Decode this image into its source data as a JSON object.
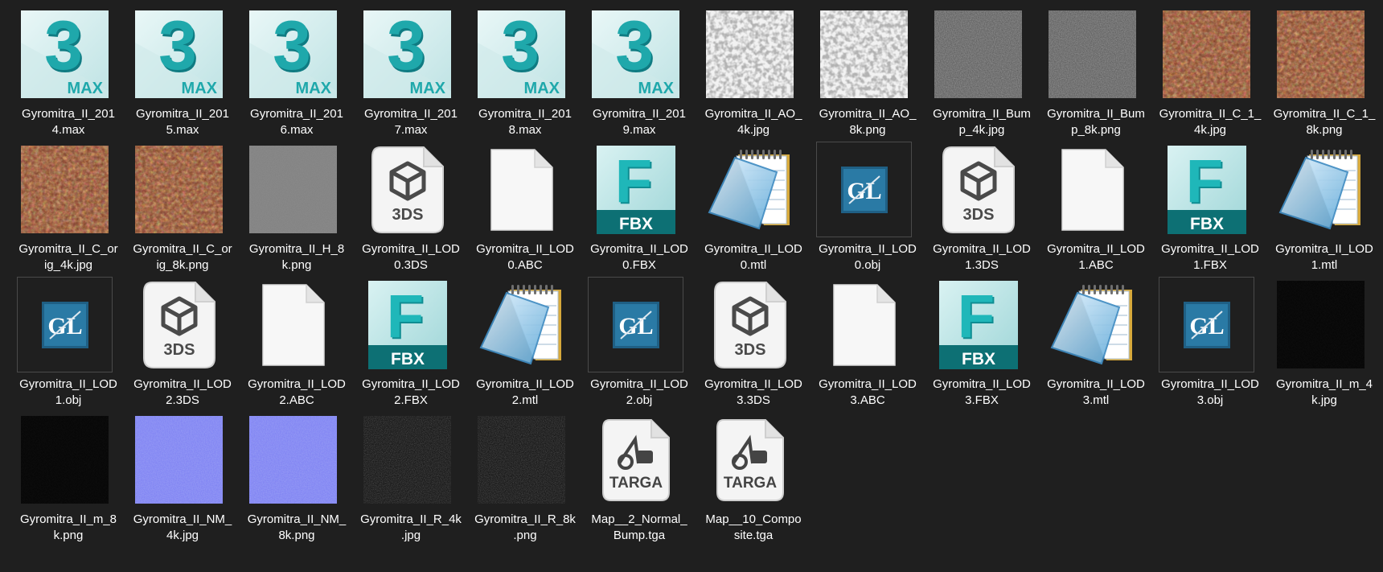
{
  "window": {
    "view": "large-icons"
  },
  "colors": {
    "background": "#1f1f1f",
    "max_teal": "#1fa8ab",
    "fbx_teal": "#0d7074",
    "text": "#ffffff"
  },
  "files": [
    {
      "line1": "Gyromitra_II_201",
      "line2": "4.max",
      "kind": "max"
    },
    {
      "line1": "Gyromitra_II_201",
      "line2": "5.max",
      "kind": "max"
    },
    {
      "line1": "Gyromitra_II_201",
      "line2": "6.max",
      "kind": "max"
    },
    {
      "line1": "Gyromitra_II_201",
      "line2": "7.max",
      "kind": "max"
    },
    {
      "line1": "Gyromitra_II_201",
      "line2": "8.max",
      "kind": "max"
    },
    {
      "line1": "Gyromitra_II_201",
      "line2": "9.max",
      "kind": "max"
    },
    {
      "line1": "Gyromitra_II_AO_",
      "line2": "4k.jpg",
      "kind": "ao"
    },
    {
      "line1": "Gyromitra_II_AO_",
      "line2": "8k.png",
      "kind": "ao"
    },
    {
      "line1": "Gyromitra_II_Bum",
      "line2": "p_4k.jpg",
      "kind": "bump"
    },
    {
      "line1": "Gyromitra_II_Bum",
      "line2": "p_8k.png",
      "kind": "bump"
    },
    {
      "line1": "Gyromitra_II_C_1_",
      "line2": "4k.jpg",
      "kind": "color"
    },
    {
      "line1": "Gyromitra_II_C_1_",
      "line2": "8k.png",
      "kind": "color"
    },
    {
      "line1": "Gyromitra_II_C_or",
      "line2": "ig_4k.jpg",
      "kind": "color"
    },
    {
      "line1": "Gyromitra_II_C_or",
      "line2": "ig_8k.png",
      "kind": "color"
    },
    {
      "line1": "Gyromitra_II_H_8",
      "line2": "k.png",
      "kind": "height"
    },
    {
      "line1": "Gyromitra_II_LOD",
      "line2": "0.3DS",
      "kind": "3ds"
    },
    {
      "line1": "Gyromitra_II_LOD",
      "line2": "0.ABC",
      "kind": "blank"
    },
    {
      "line1": "Gyromitra_II_LOD",
      "line2": "0.FBX",
      "kind": "fbx"
    },
    {
      "line1": "Gyromitra_II_LOD",
      "line2": "0.mtl",
      "kind": "notepad"
    },
    {
      "line1": "Gyromitra_II_LOD",
      "line2": "0.obj",
      "kind": "obj"
    },
    {
      "line1": "Gyromitra_II_LOD",
      "line2": "1.3DS",
      "kind": "3ds"
    },
    {
      "line1": "Gyromitra_II_LOD",
      "line2": "1.ABC",
      "kind": "blank"
    },
    {
      "line1": "Gyromitra_II_LOD",
      "line2": "1.FBX",
      "kind": "fbx"
    },
    {
      "line1": "Gyromitra_II_LOD",
      "line2": "1.mtl",
      "kind": "notepad"
    },
    {
      "line1": "Gyromitra_II_LOD",
      "line2": "1.obj",
      "kind": "obj"
    },
    {
      "line1": "Gyromitra_II_LOD",
      "line2": "2.3DS",
      "kind": "3ds"
    },
    {
      "line1": "Gyromitra_II_LOD",
      "line2": "2.ABC",
      "kind": "blank"
    },
    {
      "line1": "Gyromitra_II_LOD",
      "line2": "2.FBX",
      "kind": "fbx"
    },
    {
      "line1": "Gyromitra_II_LOD",
      "line2": "2.mtl",
      "kind": "notepad"
    },
    {
      "line1": "Gyromitra_II_LOD",
      "line2": "2.obj",
      "kind": "obj"
    },
    {
      "line1": "Gyromitra_II_LOD",
      "line2": "3.3DS",
      "kind": "3ds"
    },
    {
      "line1": "Gyromitra_II_LOD",
      "line2": "3.ABC",
      "kind": "blank"
    },
    {
      "line1": "Gyromitra_II_LOD",
      "line2": "3.FBX",
      "kind": "fbx"
    },
    {
      "line1": "Gyromitra_II_LOD",
      "line2": "3.mtl",
      "kind": "notepad"
    },
    {
      "line1": "Gyromitra_II_LOD",
      "line2": "3.obj",
      "kind": "obj"
    },
    {
      "line1": "Gyromitra_II_m_4",
      "line2": "k.jpg",
      "kind": "black"
    },
    {
      "line1": "Gyromitra_II_m_8",
      "line2": "k.png",
      "kind": "black"
    },
    {
      "line1": "Gyromitra_II_NM_",
      "line2": "4k.jpg",
      "kind": "normal"
    },
    {
      "line1": "Gyromitra_II_NM_",
      "line2": "8k.png",
      "kind": "normal"
    },
    {
      "line1": "Gyromitra_II_R_4k",
      "line2": ".jpg",
      "kind": "rough"
    },
    {
      "line1": "Gyromitra_II_R_8k",
      "line2": ".png",
      "kind": "rough"
    },
    {
      "line1": "Map__2_Normal_",
      "line2": "Bump.tga",
      "kind": "targa"
    },
    {
      "line1": "Map__10_Compo",
      "line2": "site.tga",
      "kind": "targa"
    }
  ],
  "icon_labels": {
    "max_digit": "3",
    "max_text": "MAX",
    "threeds_text": "3DS",
    "fbx_text": "FBX",
    "fbx_letter": "F",
    "obj_text": "GL",
    "targa_text": "TARGA"
  }
}
